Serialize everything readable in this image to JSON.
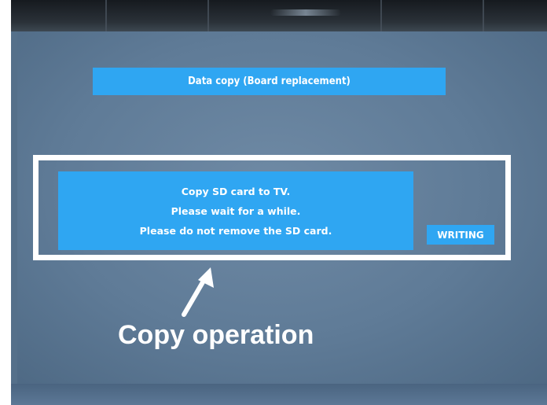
{
  "dialog": {
    "title": "Data copy (Board replacement)",
    "message_lines": [
      "Copy SD card to TV.",
      "Please wait for a while.",
      "Please do not remove the SD card."
    ],
    "status_label": "WRITING"
  },
  "annotation": {
    "caption": "Copy operation"
  },
  "colors": {
    "screen_background": "#5f7b97",
    "dialog_blue": "#2fa6f2",
    "frame_white": "#ffffff"
  }
}
